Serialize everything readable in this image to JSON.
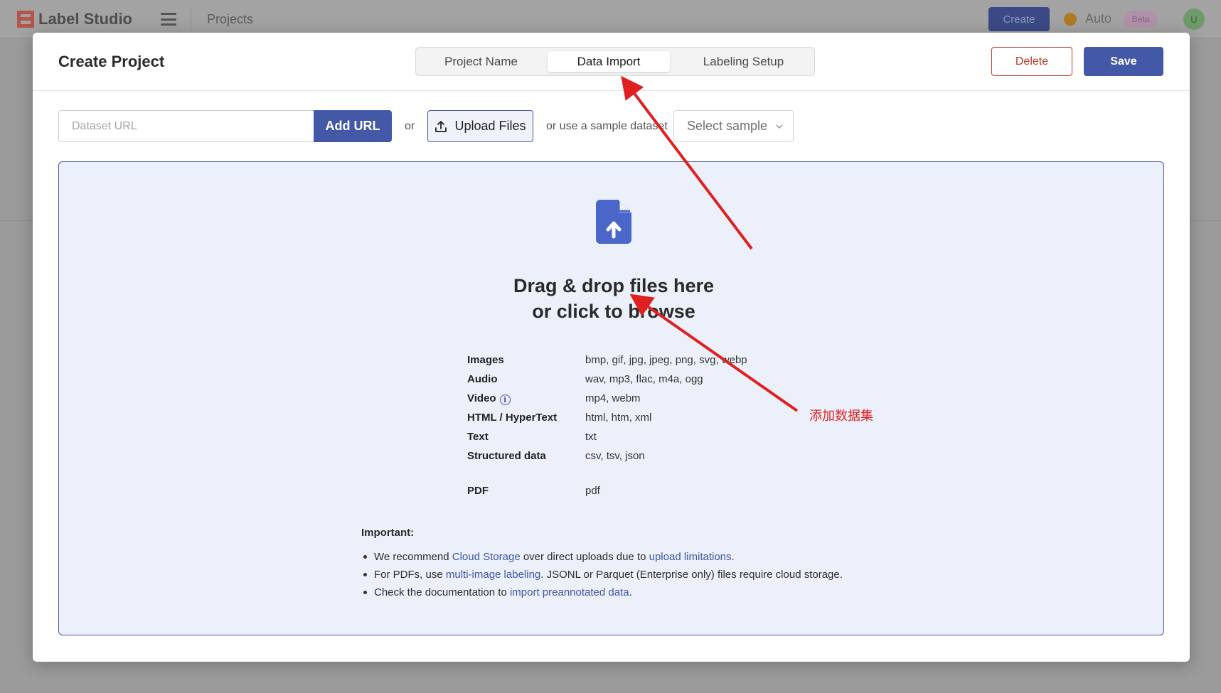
{
  "background": {
    "logo_text": "Label Studio",
    "breadcrumb": "Projects",
    "create_label": "Create",
    "auto_label": "Auto",
    "beta_label": "Beta",
    "avatar_initial": "U"
  },
  "modal": {
    "title": "Create Project",
    "tabs": [
      {
        "label": "Project Name",
        "active": false
      },
      {
        "label": "Data Import",
        "active": true
      },
      {
        "label": "Labeling Setup",
        "active": false
      }
    ],
    "delete_label": "Delete",
    "save_label": "Save"
  },
  "toolbar": {
    "url_placeholder": "Dataset URL",
    "url_value": "",
    "add_url_label": "Add URL",
    "or_label": "or",
    "upload_label": "Upload Files",
    "sample_text": "or use a sample dataset",
    "sample_select": "Select sample"
  },
  "dropzone": {
    "title_line1": "Drag & drop files here",
    "title_line2": "or click to browse",
    "formats": [
      {
        "name": "Images",
        "extensions": "bmp, gif, jpg, jpeg, png, svg, webp"
      },
      {
        "name": "Audio",
        "extensions": "wav, mp3, flac, m4a, ogg"
      },
      {
        "name": "Video",
        "extensions": "mp4, webm"
      },
      {
        "name": "HTML / HyperText",
        "extensions": "html, htm, xml"
      },
      {
        "name": "Text",
        "extensions": "txt"
      },
      {
        "name": "Structured data",
        "extensions": "csv, tsv, json"
      },
      {
        "name": "PDF",
        "extensions": "pdf"
      }
    ],
    "important": {
      "title": "Important:",
      "items": [
        {
          "pre": "We recommend ",
          "link1": "Cloud Storage",
          "mid": " over direct uploads due to ",
          "link2": "upload limitations",
          "post": "."
        },
        {
          "pre": "For PDFs, use ",
          "link1": "multi-image labeling",
          "post": ". JSONL or Parquet (Enterprise only) files require cloud storage."
        },
        {
          "pre": "Check the documentation to ",
          "link1": "import preannotated data",
          "post": "."
        }
      ]
    }
  },
  "annotation": {
    "label": "添加数据集",
    "color": "#e02020"
  },
  "colors": {
    "primary": "#4358a6",
    "danger": "#c0392b",
    "dropzone_bg": "#ecf0fb"
  }
}
